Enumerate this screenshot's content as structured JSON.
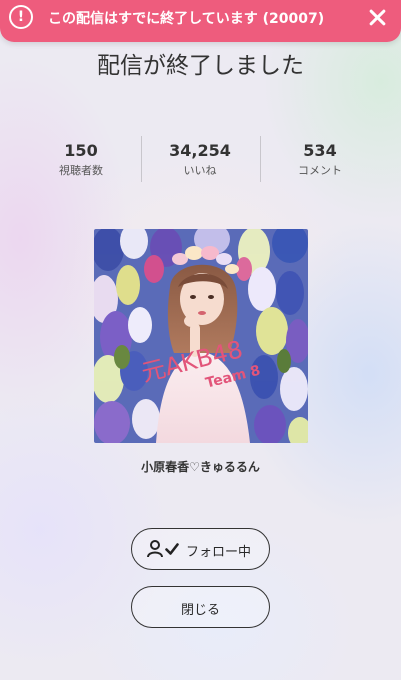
{
  "toast": {
    "icon": "alert-circle-icon",
    "icon_glyph": "!",
    "message": "この配信はすでに終了しています (20007)",
    "close_icon": "close-icon"
  },
  "title": "配信が終了しました",
  "stats": [
    {
      "value": "150",
      "label": "視聴者数"
    },
    {
      "value": "34,254",
      "label": "いいね"
    },
    {
      "value": "534",
      "label": "コメント"
    }
  ],
  "profile": {
    "photo_caption": "元AKB48",
    "photo_subcaption": "Team 8",
    "name": "小原春香♡きゅるるん"
  },
  "buttons": {
    "follow_label": "フォロー中",
    "follow_icons": [
      "person-icon",
      "check-icon"
    ],
    "close_label": "閉じる"
  },
  "colors": {
    "toast_bg": "#ee5c7d",
    "caption_pink": "#e2557a"
  }
}
